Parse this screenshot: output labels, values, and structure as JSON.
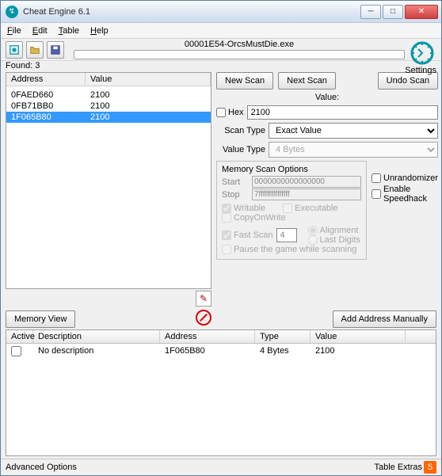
{
  "title": "Cheat Engine 6.1",
  "menu": {
    "file": "File",
    "edit": "Edit",
    "table": "Table",
    "help": "Help"
  },
  "process": "00001E54-OrcsMustDie.exe",
  "settings_label": "Settings",
  "found_label": "Found: 3",
  "results": {
    "header_address": "Address",
    "header_value": "Value",
    "rows": [
      {
        "addr": "0FAED660",
        "val": "2100",
        "selected": false
      },
      {
        "addr": "0FB71BB0",
        "val": "2100",
        "selected": false
      },
      {
        "addr": "1F065B80",
        "val": "2100",
        "selected": true
      }
    ]
  },
  "scan": {
    "new_scan": "New Scan",
    "next_scan": "Next Scan",
    "undo_scan": "Undo Scan",
    "value_label": "Value:",
    "hex_label": "Hex",
    "value_input": "2100",
    "scan_type_label": "Scan Type",
    "scan_type_value": "Exact Value",
    "value_type_label": "Value Type",
    "value_type_value": "4 Bytes",
    "mem_options_title": "Memory Scan Options",
    "start_label": "Start",
    "stop_label": "Stop",
    "start_value": "0000000000000000",
    "stop_value": "7fffffffffffffff",
    "writable": "Writable",
    "executable": "Executable",
    "copyonwrite": "CopyOnWrite",
    "fast_scan": "Fast Scan",
    "fast_scan_value": "4",
    "alignment": "Alignment",
    "last_digits": "Last Digits",
    "pause_game": "Pause the game while scanning",
    "unrandomizer": "Unrandomizer",
    "enable_speedhack": "Enable Speedhack"
  },
  "buttons": {
    "memory_view": "Memory View",
    "add_address": "Add Address Manually"
  },
  "address_table": {
    "headers": {
      "active": "Active",
      "description": "Description",
      "address": "Address",
      "type": "Type",
      "value": "Value"
    },
    "rows": [
      {
        "active": false,
        "description": "No description",
        "address": "1F065B80",
        "type": "4 Bytes",
        "value": "2100"
      }
    ]
  },
  "footer": {
    "advanced": "Advanced Options",
    "table_extras": "Table Extras"
  }
}
